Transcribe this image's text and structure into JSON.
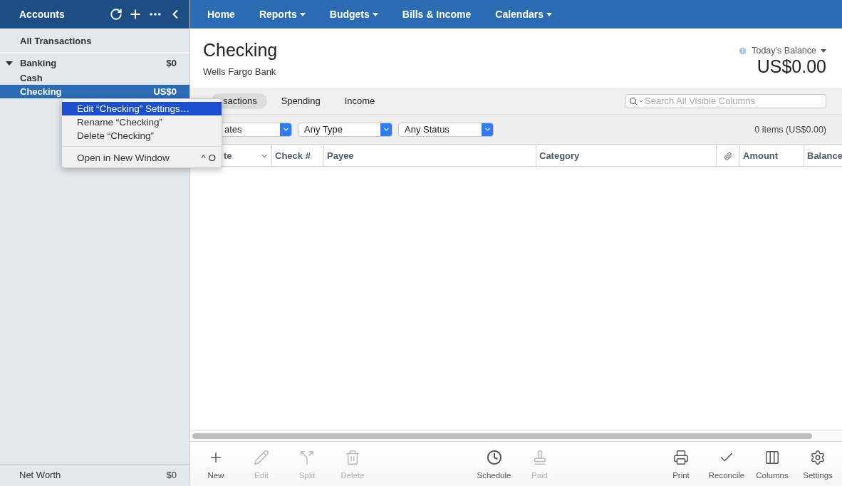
{
  "sidebar": {
    "title": "Accounts",
    "all_transactions": "All Transactions",
    "groups": [
      {
        "name": "Banking",
        "total": "$0",
        "expanded": true,
        "children": [
          {
            "name": "Cash",
            "selected": false
          },
          {
            "name": "Checking",
            "amount": "US$0",
            "selected": true
          }
        ]
      }
    ],
    "net_worth": {
      "label": "Net Worth",
      "value": "$0"
    }
  },
  "nav": [
    {
      "label": "Home",
      "dropdown": false
    },
    {
      "label": "Reports",
      "dropdown": true
    },
    {
      "label": "Budgets",
      "dropdown": true
    },
    {
      "label": "Bills & Income",
      "dropdown": false
    },
    {
      "label": "Calendars",
      "dropdown": true
    }
  ],
  "account": {
    "title": "Checking",
    "subtitle": "Wells Fargo Bank",
    "balance_label": "Today’s Balance",
    "balance": "US$0.00"
  },
  "view_tabs": [
    {
      "label": "sactions",
      "selected": true
    },
    {
      "label": "Spending",
      "selected": false
    },
    {
      "label": "Income",
      "selected": false
    }
  ],
  "search": {
    "placeholder": "Search All Visible Columns"
  },
  "filters": [
    {
      "value": "ates"
    },
    {
      "value": "Any Type"
    },
    {
      "value": "Any Status"
    }
  ],
  "summary": "0 items (US$0.00)",
  "columns": [
    {
      "kind": "blank"
    },
    {
      "kind": "sort",
      "label": "te"
    },
    {
      "kind": "text",
      "label": "Check #"
    },
    {
      "kind": "text",
      "label": "Payee"
    },
    {
      "kind": "text",
      "label": "Category"
    },
    {
      "kind": "attachment"
    },
    {
      "kind": "text",
      "label": "Amount"
    },
    {
      "kind": "text",
      "label": "Balance"
    }
  ],
  "toolbar": [
    {
      "items": [
        {
          "kind": "new",
          "label": "New",
          "disabled": false
        },
        {
          "kind": "edit",
          "label": "Edit",
          "disabled": true
        },
        {
          "kind": "split",
          "label": "Split",
          "disabled": true
        },
        {
          "kind": "delete",
          "label": "Delete",
          "disabled": true
        }
      ]
    },
    {
      "items": [
        {
          "kind": "schedule",
          "label": "Schedule",
          "disabled": false
        },
        {
          "kind": "paid",
          "label": "Paid",
          "disabled": true
        }
      ]
    },
    {
      "items": [
        {
          "kind": "print",
          "label": "Print",
          "disabled": false
        },
        {
          "kind": "reconcile",
          "label": "Reconcile",
          "disabled": false
        },
        {
          "kind": "columns",
          "label": "Columns",
          "disabled": false
        },
        {
          "kind": "settings",
          "label": "Settings",
          "disabled": false
        }
      ]
    }
  ],
  "context_menu": {
    "sections": [
      {
        "items": [
          {
            "label": "Edit “Checking” Settings…",
            "selected": true
          },
          {
            "label": "Rename “Checking”",
            "selected": false
          },
          {
            "label": "Delete “Checking”",
            "selected": false
          }
        ]
      },
      {
        "items": [
          {
            "label": "Open in New Window",
            "shortcut": "^ O",
            "selected": false
          }
        ]
      }
    ]
  }
}
